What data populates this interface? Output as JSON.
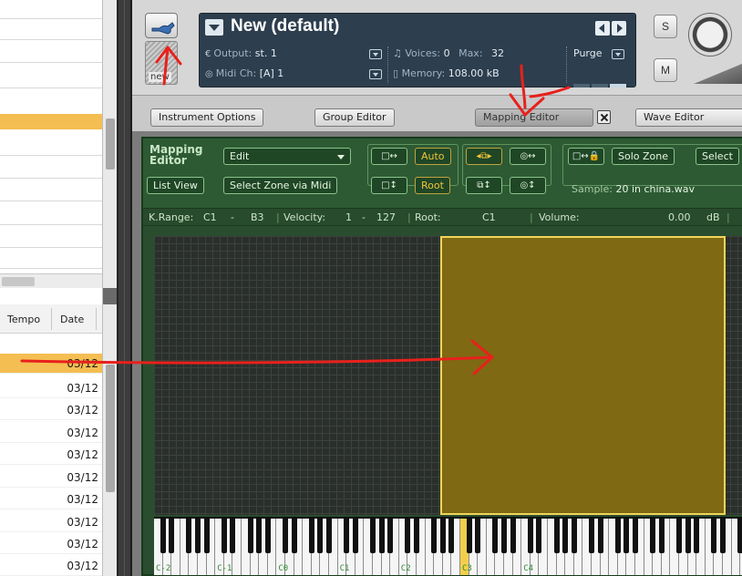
{
  "browser": {
    "columns": {
      "tempo": "Tempo",
      "date": "Date"
    },
    "rows": [
      "03/12",
      "03/12",
      "03/12",
      "03/12",
      "03/12",
      "03/12",
      "03/12",
      "03/12",
      "03/12",
      "03/12",
      "03/12"
    ],
    "selected_row_index": 0
  },
  "instrument": {
    "name": "New (default)",
    "new_label": "new",
    "output_label": "Output:",
    "output_value": "st. 1",
    "midi_label": "Midi Ch:",
    "midi_value": "[A] 1",
    "voices_label": "Voices:",
    "voices_value": "0",
    "max_label": "Max:",
    "max_value": "32",
    "memory_label": "Memory:",
    "memory_value": "108.00 kB",
    "purge_label": "Purge",
    "solo_label": "S",
    "mute_label": "M"
  },
  "tabs": [
    {
      "label": "Instrument Options"
    },
    {
      "label": "Group Editor"
    },
    {
      "label": "Mapping Editor",
      "active": true
    },
    {
      "label": "Wave Editor"
    }
  ],
  "mapping_editor": {
    "title": "Mapping Editor",
    "edit_menu": "Edit",
    "list_view": "List View",
    "select_zone_midi": "Select Zone via Midi",
    "auto": "Auto",
    "root": "Root",
    "solo_zone": "Solo Zone",
    "select": "Select",
    "sample_label": "Sample:",
    "sample_value": "20 in china.wav",
    "status": {
      "krange_label": "K.Range:",
      "krange_low": "C1",
      "krange_dash": "-",
      "krange_high": "B3",
      "velocity_label": "Velocity:",
      "velocity_low": "1",
      "velocity_dash": "-",
      "velocity_high": "127",
      "root_label": "Root:",
      "root_value": "C1",
      "volume_label": "Volume:",
      "volume_value": "0.00",
      "volume_unit": "dB"
    },
    "keyboard_octaves": [
      "C-2",
      "C-1",
      "C0",
      "C1",
      "C2",
      "C3",
      "C4"
    ]
  },
  "colors": {
    "annotation": "#e8211c",
    "zone_fill": "#7f6913",
    "zone_border": "#f1d55a",
    "selection": "#f4be52",
    "display_bg": "#2d3e4e",
    "editor_bg": "#2d5a33"
  },
  "icons": [
    "wrench-icon",
    "dropdown-arrow-icon",
    "prev-arrow-icon",
    "next-arrow-icon",
    "close-icon",
    "midi-icon",
    "output-icon"
  ]
}
